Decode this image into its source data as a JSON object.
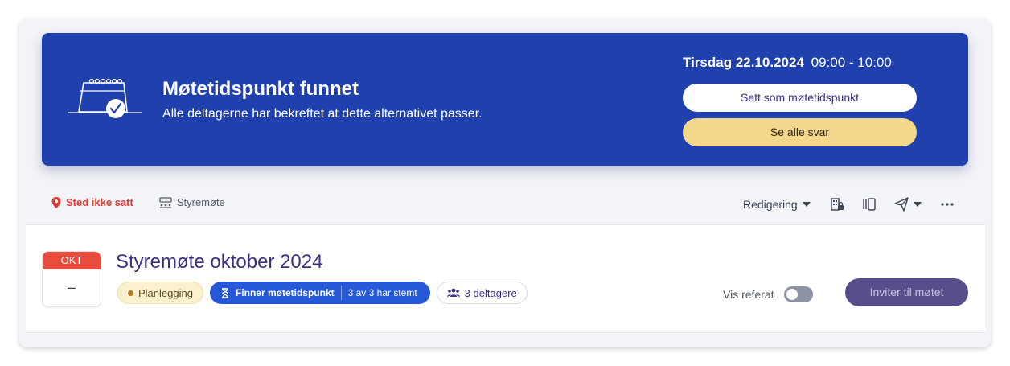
{
  "banner": {
    "title": "Møtetidspunkt funnet",
    "subtitle": "Alle deltagerne har bekreftet at dette alternativet passer.",
    "date": "Tirsdag 22.10.2024",
    "time": "09:00 - 10:00",
    "primary_button": "Sett som møtetidspunkt",
    "secondary_button": "Se alle svar",
    "colors": {
      "background": "#1f40ad",
      "secondary_button": "#f2d78c"
    }
  },
  "meta": {
    "location": "Sted ikke satt",
    "room": "Styremøte",
    "mode": "Redigering"
  },
  "meeting": {
    "month": "OKT",
    "day": "–",
    "title": "Styremøte oktober 2024",
    "status": "Planlegging",
    "finder_label": "Finner møtetidspunkt",
    "votes": "3 av 3 har stemt",
    "participants": "3 deltagere",
    "minutes_label": "Vis referat",
    "minutes_toggle_on": false,
    "invite_button": "Inviter til møtet"
  },
  "icons": [
    "calendar-check-illustration",
    "location-pin-icon",
    "meeting-room-icon",
    "chevron-down-icon",
    "building-lock-icon",
    "columns-icon",
    "send-icon",
    "more-icon",
    "hourglass-icon",
    "people-icon"
  ]
}
